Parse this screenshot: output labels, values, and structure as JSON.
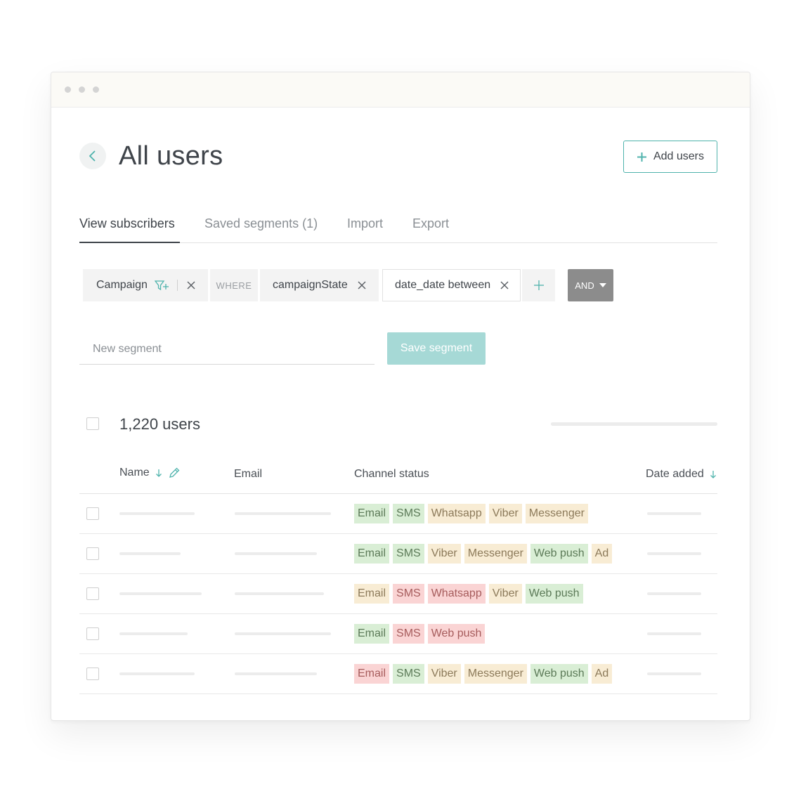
{
  "header": {
    "title": "All users",
    "add_users_label": "Add users"
  },
  "tabs": [
    {
      "label": "View subscribers",
      "active": true
    },
    {
      "label": "Saved segments (1)",
      "active": false
    },
    {
      "label": "Import",
      "active": false
    },
    {
      "label": "Export",
      "active": false
    }
  ],
  "filters": {
    "campaign_label": "Campaign",
    "where_label": "WHERE",
    "condition_1": "campaignState",
    "condition_2": "date_date between",
    "operator_label": "AND"
  },
  "segment": {
    "placeholder": "New segment",
    "save_label": "Save segment"
  },
  "users": {
    "count_label": "1,220 users"
  },
  "table": {
    "columns": {
      "name": "Name",
      "email": "Email",
      "channel_status": "Channel status",
      "date_added": "Date added"
    },
    "rows": [
      {
        "channels": [
          {
            "label": "Email",
            "status": "green"
          },
          {
            "label": "SMS",
            "status": "green"
          },
          {
            "label": "Whatsapp",
            "status": "yellow"
          },
          {
            "label": "Viber",
            "status": "yellow"
          },
          {
            "label": "Messenger",
            "status": "yellow"
          }
        ]
      },
      {
        "channels": [
          {
            "label": "Email",
            "status": "green"
          },
          {
            "label": "SMS",
            "status": "green"
          },
          {
            "label": "Viber",
            "status": "yellow"
          },
          {
            "label": "Messenger",
            "status": "yellow"
          },
          {
            "label": "Web push",
            "status": "green"
          },
          {
            "label": "Ad",
            "status": "yellow"
          }
        ]
      },
      {
        "channels": [
          {
            "label": "Email",
            "status": "yellow"
          },
          {
            "label": "SMS",
            "status": "red"
          },
          {
            "label": "Whatsapp",
            "status": "red"
          },
          {
            "label": "Viber",
            "status": "yellow"
          },
          {
            "label": "Web push",
            "status": "green"
          }
        ]
      },
      {
        "channels": [
          {
            "label": "Email",
            "status": "green"
          },
          {
            "label": "SMS",
            "status": "red"
          },
          {
            "label": "Web push",
            "status": "red"
          }
        ]
      },
      {
        "channels": [
          {
            "label": "Email",
            "status": "red"
          },
          {
            "label": "SMS",
            "status": "green"
          },
          {
            "label": "Viber",
            "status": "yellow"
          },
          {
            "label": "Messenger",
            "status": "yellow"
          },
          {
            "label": "Web push",
            "status": "green"
          },
          {
            "label": "Ad",
            "status": "yellow"
          }
        ]
      }
    ]
  },
  "colors": {
    "accent": "#4fb3ac",
    "save_button": "#a6d9d6",
    "status_green": "#d9eed5",
    "status_yellow": "#f8ecd4",
    "status_red": "#fad4d4"
  },
  "icons": {
    "back": "chevron-left-icon",
    "add": "plus-icon",
    "filter_add": "filter-plus-icon",
    "remove": "close-icon",
    "sort": "arrow-down-icon",
    "edit": "pencil-icon",
    "dropdown": "caret-down-icon"
  }
}
